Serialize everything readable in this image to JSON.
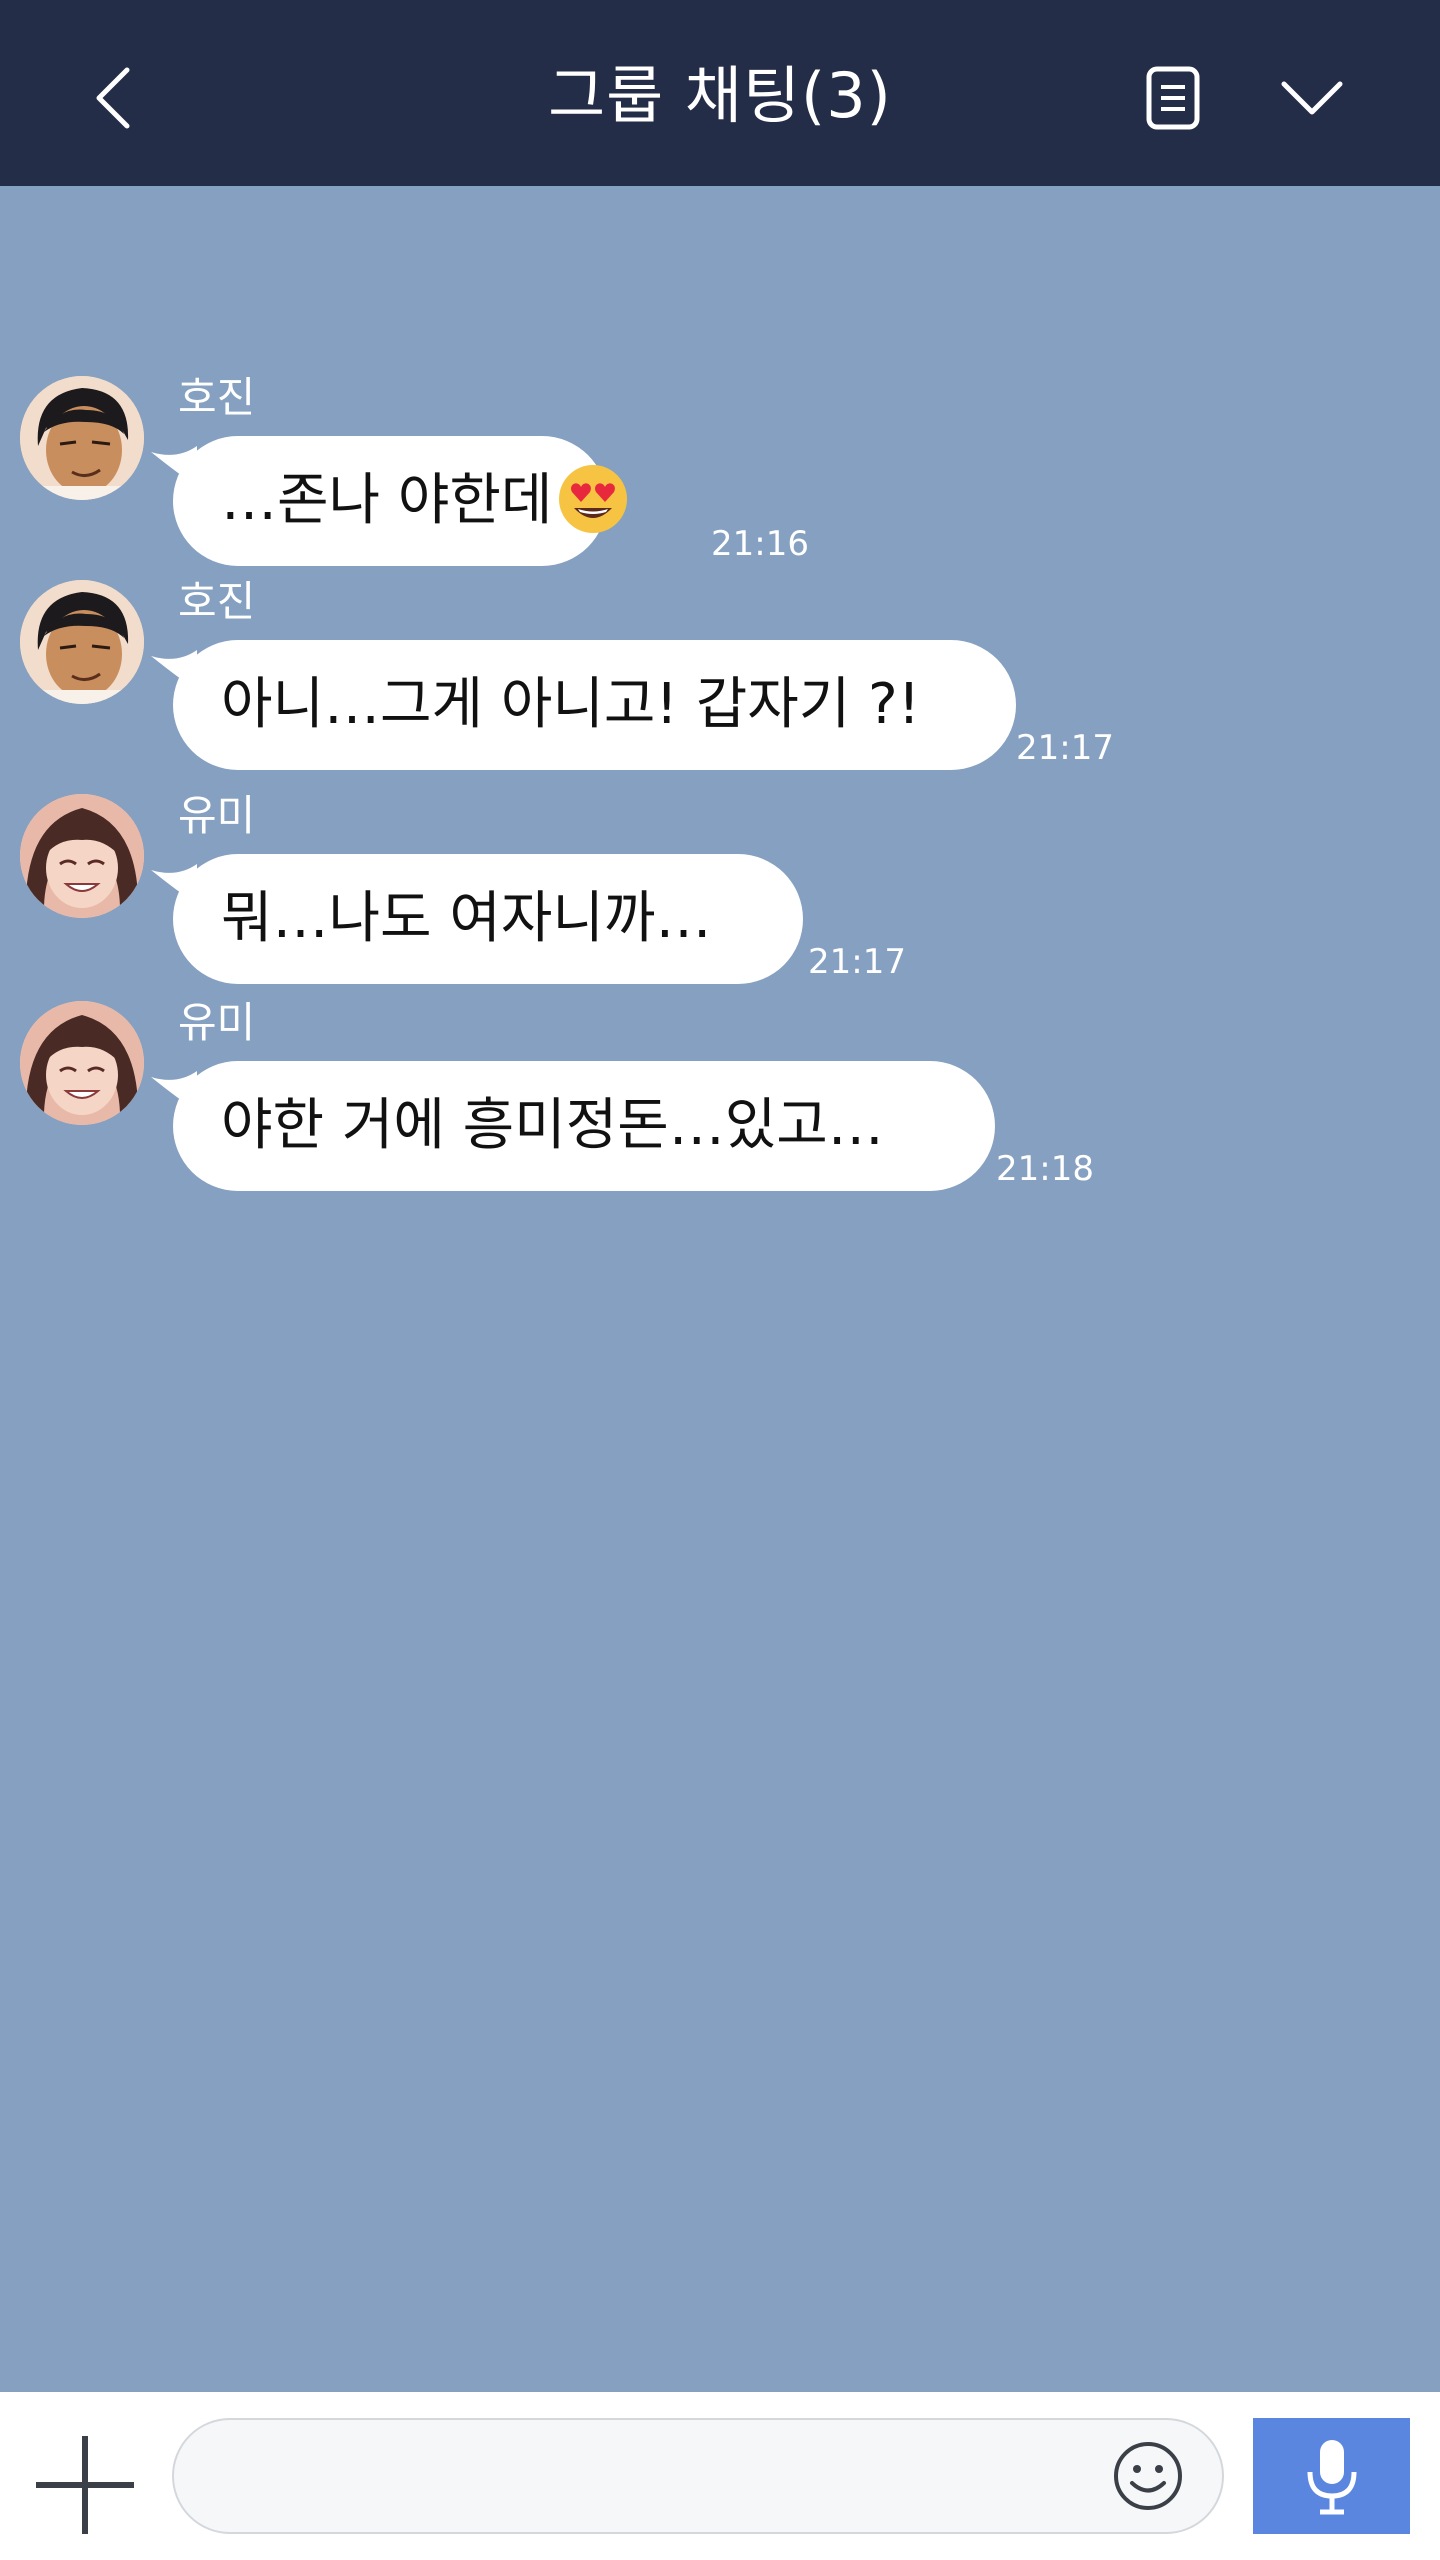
{
  "header": {
    "title": "그룹 채팅(3)",
    "back_icon": "chevron-left-icon",
    "notes_icon": "note-icon",
    "menu_icon": "chevron-down-icon",
    "background": "#242d47"
  },
  "chat": {
    "background": "#85a0c0",
    "messages": [
      {
        "sender": "호진",
        "text": "…존나 야한데",
        "emoji": "heart-eyes-emoji",
        "time": "21:16"
      },
      {
        "sender": "호진",
        "text": "아니…그게 아니고! 갑자기 ?!",
        "time": "21:17"
      },
      {
        "sender": "유미",
        "text": "뭐…나도 여자니까…",
        "time": "21:17"
      },
      {
        "sender": "유미",
        "text": "야한 거에 흥미정돈…있고…",
        "time": "21:18"
      }
    ]
  },
  "input": {
    "value": "",
    "placeholder": "",
    "plus_icon": "plus-icon",
    "emoji_icon": "smiley-icon",
    "mic_icon": "microphone-icon",
    "mic_color": "#5a86e0"
  }
}
